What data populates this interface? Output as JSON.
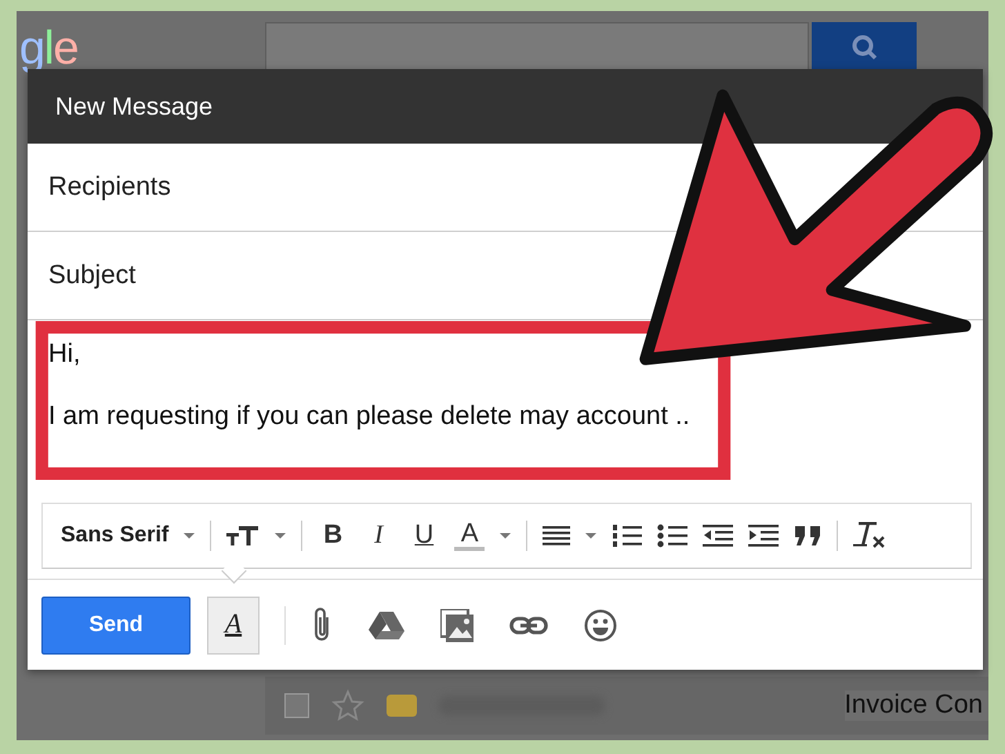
{
  "background": {
    "logo": "gle",
    "mail_row": {
      "checked": false,
      "subject": "Invoice Con"
    }
  },
  "compose": {
    "title": "New Message",
    "recipients": {
      "placeholder": "Recipients"
    },
    "subject": {
      "placeholder": "Subject"
    },
    "body": [
      "Hi,",
      "I am requesting if you can please delete may account .."
    ],
    "toolbar": {
      "font": "Sans Serif",
      "bold": "B",
      "italic": "I",
      "underline": "U",
      "text_color": "A"
    },
    "send": "Send",
    "formatting": {
      "label": "A",
      "selected": true
    }
  }
}
